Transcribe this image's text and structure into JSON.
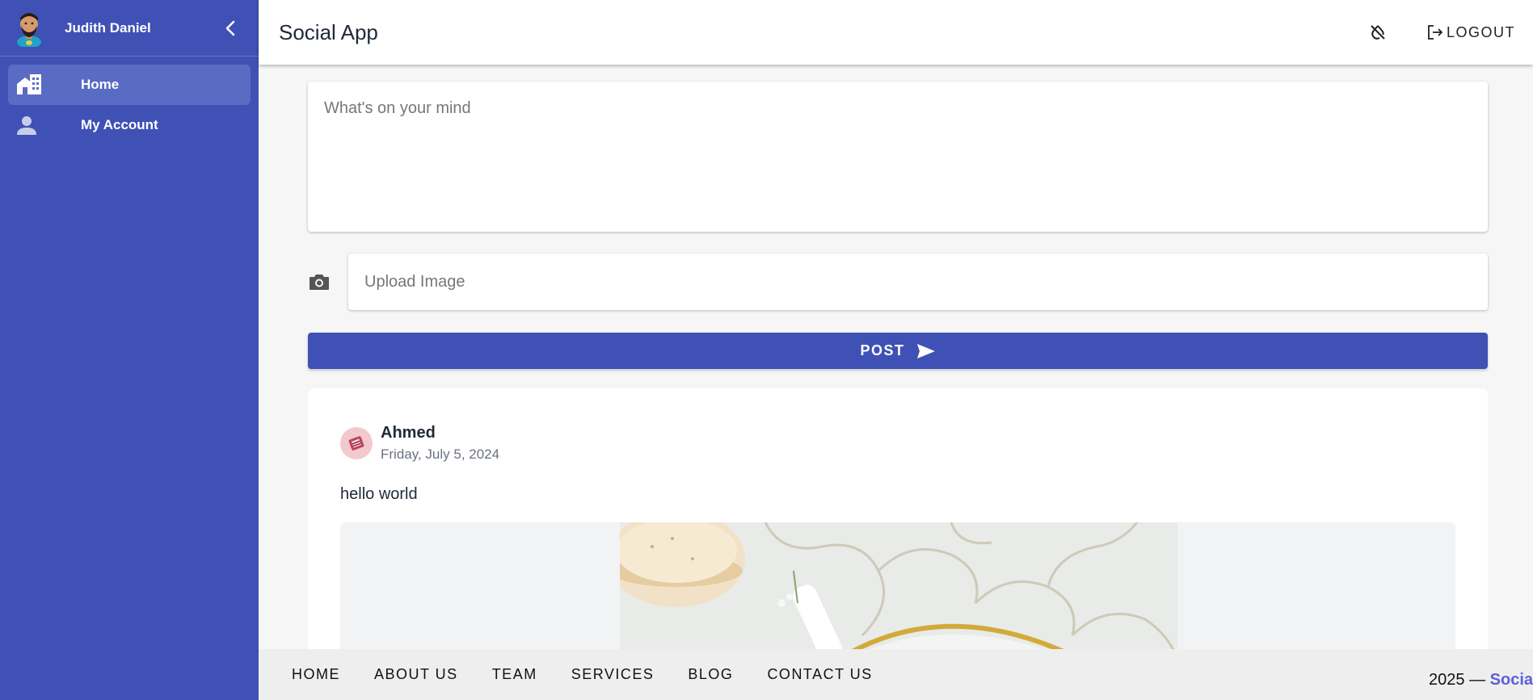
{
  "sidebar": {
    "user_name": "Judith Daniel",
    "items": [
      {
        "label": "Home",
        "icon": "home-icon",
        "active": true
      },
      {
        "label": "My Account",
        "icon": "person-icon",
        "active": false
      }
    ],
    "color": "#3f51b5"
  },
  "topbar": {
    "title": "Social App",
    "logout_label": "LOGOUT"
  },
  "composer": {
    "placeholder": "What's on your mind",
    "value": ""
  },
  "upload": {
    "placeholder": "Upload Image"
  },
  "post_button": {
    "label": "POST"
  },
  "posts": [
    {
      "author": "Ahmed",
      "date": "Friday, July 5, 2024",
      "text": "hello world"
    }
  ],
  "footer": {
    "links": [
      "HOME",
      "ABOUT US",
      "TEAM",
      "SERVICES",
      "BLOG",
      "CONTACT US"
    ],
    "copyright_prefix": "2025 —",
    "brand": "Socia"
  }
}
